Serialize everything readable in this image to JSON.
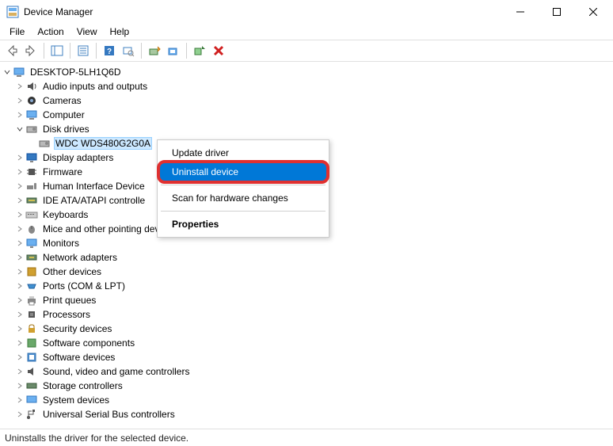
{
  "window": {
    "title": "Device Manager"
  },
  "menu": {
    "file": "File",
    "action": "Action",
    "view": "View",
    "help": "Help"
  },
  "tree": {
    "root": "DESKTOP-5LH1Q6D",
    "audio": "Audio inputs and outputs",
    "cameras": "Cameras",
    "computer": "Computer",
    "diskdrives": "Disk drives",
    "disk0": "WDC WDS480G2G0A",
    "display": "Display adapters",
    "firmware": "Firmware",
    "hid": "Human Interface Device",
    "ide": "IDE ATA/ATAPI controlle",
    "keyboards": "Keyboards",
    "mice": "Mice and other pointing devices",
    "monitors": "Monitors",
    "network": "Network adapters",
    "other": "Other devices",
    "ports": "Ports (COM & LPT)",
    "printq": "Print queues",
    "processors": "Processors",
    "security": "Security devices",
    "swcomp": "Software components",
    "swdev": "Software devices",
    "sound": "Sound, video and game controllers",
    "storage": "Storage controllers",
    "system": "System devices",
    "usb": "Universal Serial Bus controllers"
  },
  "context": {
    "update": "Update driver",
    "uninstall": "Uninstall device",
    "scan": "Scan for hardware changes",
    "properties": "Properties"
  },
  "status": {
    "text": "Uninstalls the driver for the selected device."
  }
}
